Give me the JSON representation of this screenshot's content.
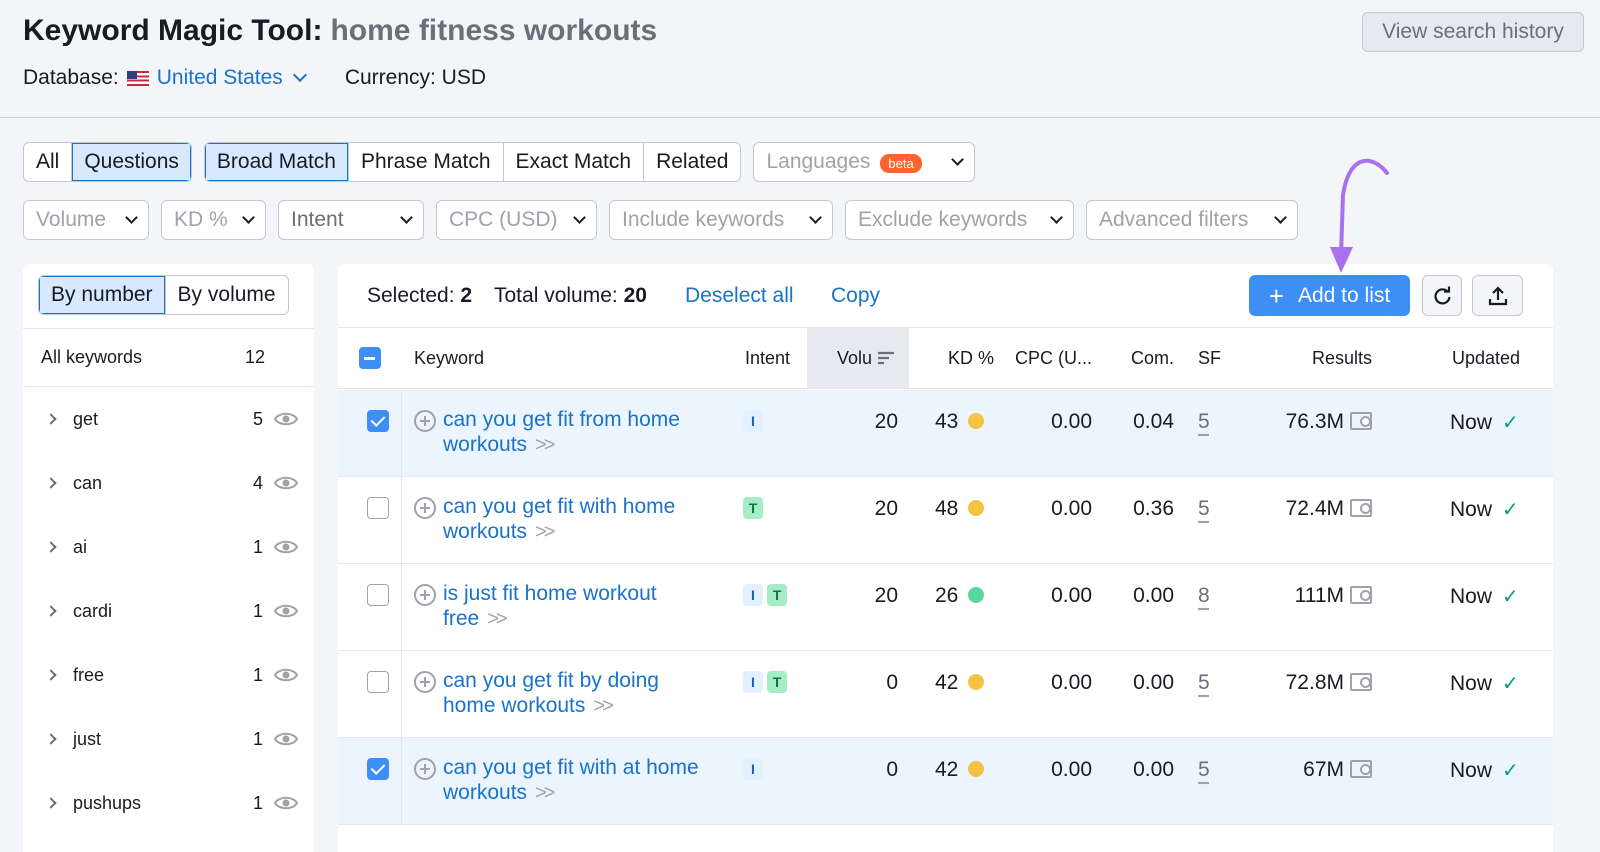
{
  "header": {
    "title": "Keyword Magic Tool:",
    "query": "home fitness workouts",
    "history_button": "View search history",
    "database_label": "Database:",
    "database_value": "United States",
    "currency": "Currency: USD"
  },
  "filters": {
    "type_tabs": [
      "All",
      "Questions"
    ],
    "match_tabs": [
      "Broad Match",
      "Phrase Match",
      "Exact Match",
      "Related"
    ],
    "languages": "Languages",
    "beta": "beta",
    "dropdowns": [
      "Volume",
      "KD %",
      "Intent",
      "CPC (USD)",
      "Include keywords",
      "Exclude keywords",
      "Advanced filters"
    ]
  },
  "sidebar": {
    "tabs": [
      "By number",
      "By volume"
    ],
    "all_label": "All keywords",
    "all_count": "12",
    "items": [
      {
        "word": "get",
        "count": "5"
      },
      {
        "word": "can",
        "count": "4"
      },
      {
        "word": "ai",
        "count": "1"
      },
      {
        "word": "cardi",
        "count": "1"
      },
      {
        "word": "free",
        "count": "1"
      },
      {
        "word": "just",
        "count": "1"
      },
      {
        "word": "pushups",
        "count": "1"
      }
    ]
  },
  "toolbar": {
    "selected_label": "Selected:",
    "selected_value": "2",
    "total_label": "Total volume:",
    "total_value": "20",
    "deselect": "Deselect all",
    "copy": "Copy",
    "add_to_list": "Add to list"
  },
  "table": {
    "columns": [
      "Keyword",
      "Intent",
      "Volu",
      "KD %",
      "CPC (U...",
      "Com.",
      "SF",
      "Results",
      "Updated"
    ],
    "rows": [
      {
        "selected": true,
        "keyword_l1": "can you get fit from home",
        "keyword_l2": "workouts",
        "intent": [
          "I"
        ],
        "volume": "20",
        "kd": "43",
        "kd_color": "#f5c342",
        "cpc": "0.00",
        "com": "0.04",
        "sf": "5",
        "results": "76.3M",
        "updated": "Now"
      },
      {
        "selected": false,
        "keyword_l1": "can you get fit with home",
        "keyword_l2": "workouts",
        "intent": [
          "T"
        ],
        "volume": "20",
        "kd": "48",
        "kd_color": "#f5c342",
        "cpc": "0.00",
        "com": "0.36",
        "sf": "5",
        "results": "72.4M",
        "updated": "Now"
      },
      {
        "selected": false,
        "keyword_l1": "is just fit home workout",
        "keyword_l2": "free",
        "intent": [
          "I",
          "T"
        ],
        "volume": "20",
        "kd": "26",
        "kd_color": "#59d69b",
        "cpc": "0.00",
        "com": "0.00",
        "sf": "8",
        "results": "111M",
        "updated": "Now"
      },
      {
        "selected": false,
        "keyword_l1": "can you get fit by doing",
        "keyword_l2": "home workouts",
        "intent": [
          "I",
          "T"
        ],
        "volume": "0",
        "kd": "42",
        "kd_color": "#f5c342",
        "cpc": "0.00",
        "com": "0.00",
        "sf": "5",
        "results": "72.8M",
        "updated": "Now"
      },
      {
        "selected": true,
        "keyword_l1": "can you get fit with at home",
        "keyword_l2": "workouts",
        "intent": [
          "I"
        ],
        "volume": "0",
        "kd": "42",
        "kd_color": "#f5c342",
        "cpc": "0.00",
        "com": "0.00",
        "sf": "5",
        "results": "67M",
        "updated": "Now"
      }
    ]
  },
  "colors": {
    "accent": "#3d8ff6",
    "link": "#1a73c9",
    "annotation_arrow": "#a970f0"
  }
}
